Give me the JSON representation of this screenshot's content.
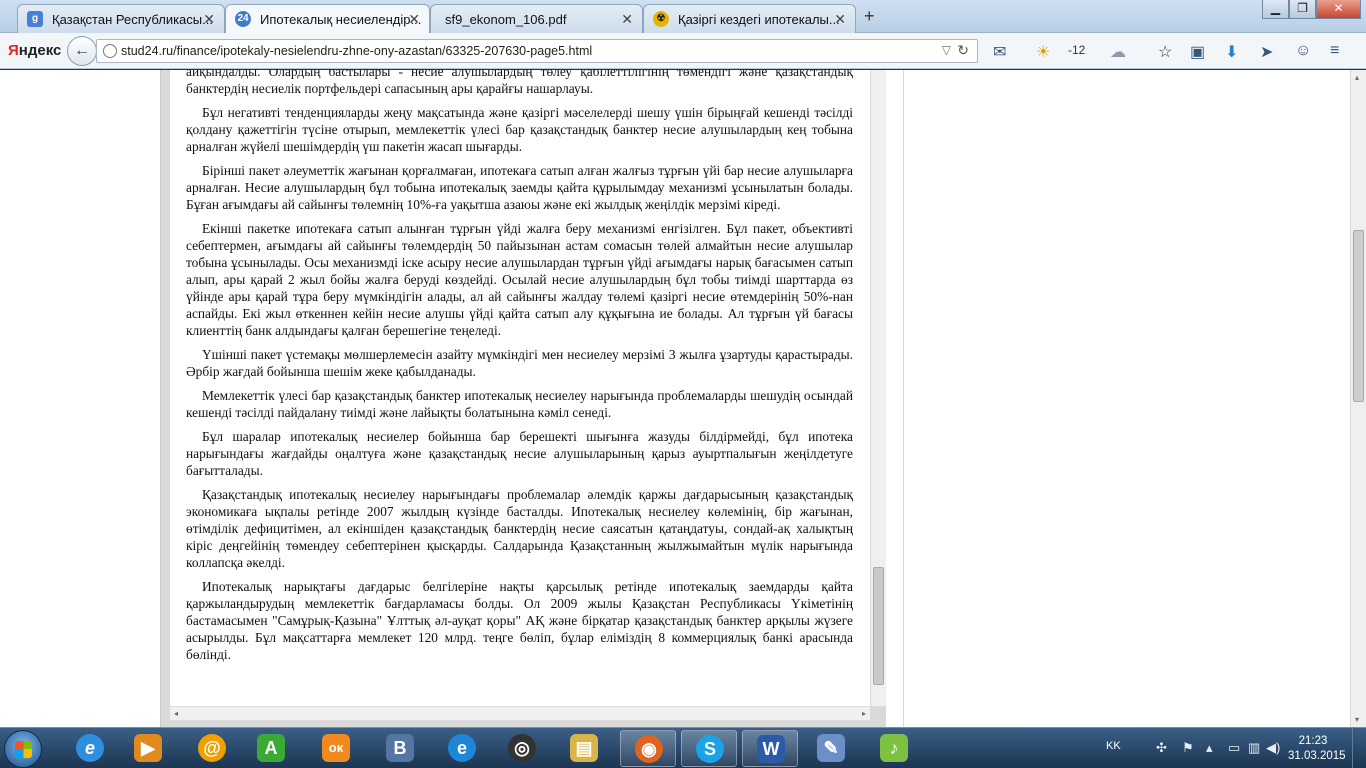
{
  "browser": {
    "tabs": [
      {
        "label": "Қазақстан Республикасы...",
        "icon": "google-plus-icon",
        "color": "#4a7fd4"
      },
      {
        "label": "Ипотекалық несиелендір...",
        "icon": "stud24-icon",
        "color": "#3c7dc9"
      },
      {
        "label": "sf9_ekonom_106.pdf",
        "icon": "",
        "color": ""
      },
      {
        "label": "Қазіргі кездегі ипотекалы...",
        "icon": "radiation-icon",
        "color": "#e8b400"
      }
    ],
    "new_tab": "+",
    "logo_y": "Я",
    "logo_rest": "ндекс",
    "url": "stud24.ru/finance/ipotekaly-nesielendru-zhne-ony-azastan/63325-207630-page5.html",
    "weather_temp": "-12"
  },
  "document": {
    "paragraphs": [
      "айқындалды. Олардың бастылары - несие алушылардың төлеу қабілеттілігінің төмендігі және қазақстандық банктердің несиелік портфельдері сапасының ары қарайғы нашарлауы.",
      "Бұл негативті тенденцияларды жеңу мақсатында және қазіргі мәселелерді шешу үшін бірыңғай кешенді тәсілді қолдану қажеттігін түсіне отырып, мемлекеттік үлесі бар қазақстандық банктер несие алушылардың кең тобына арналған жүйелі шешімдердің үш пакетін жасап шығарды.",
      "Бірінші пакет әлеуметтік жағынан қорғалмаған, ипотекаға сатып алған жалғыз тұрғын үйі бар несие алушыларға арналған. Несие алушылардың бұл тобына ипотекалық заемды қайта құрылымдау механизмі ұсынылатын болады. Бұған ағымдағы ай сайынғы төлемнің 10%-ға уақытша азаюы және екі жылдық жеңілдік мерзімі кіреді.",
      "Екінші пакетке ипотекаға сатып алынған тұрғын үйді жалға беру механизмі енгізілген. Бұл пакет, объективті себептермен, ағымдағы ай сайынғы төлемдердің 50 пайызынан астам сомасын төлей алмайтын несие алушылар тобына ұсынылады. Осы механизмді іске асыру несие алушылардан тұрғын үйді ағымдағы нарық бағасымен сатып алып, ары қарай 2 жыл бойы жалға беруді көздейді. Осылай несие алушылардың бұл тобы тиімді шарттарда өз үйінде ары қарай тұра беру мүмкіндігін алады, ал ай сайынғы жалдау төлемі қазіргі несие өтемдерінің 50%-нан аспайды. Екі жыл өткеннен кейін несие алушы үйді қайта сатып алу құқығына ие болады. Ал тұрғын үй бағасы клиенттің банк алдындағы қалған берешегіне теңеледі.",
      "Үшінші пакет үстемақы мөлшерлемесін азайту мүмкіндігі мен несиелеу мерзімі 3 жылға ұзартуды қарастырады. Әрбір жағдай бойынша шешім жеке қабылданады.",
      "Мемлекеттік үлесі бар қазақстандық банктер ипотекалық несиелеу нарығында проблемаларды шешудің осындай кешенді тәсілді пайдалану тиімді және лайықты болатынына кәміл сенеді.",
      "Бұл шаралар ипотекалық несиелер бойынша бар берешекті шығынға жазуды білдірмейді, бұл ипотека нарығындағы жағдайды оңалтуға және қазақстандық несие алушыларының қарыз ауыртпалығын жеңілдетуге бағытталады.",
      "Қазақстандық ипотекалық несиелеу нарығындағы проблемалар әлемдік қаржы дағдарысының қазақстандық экономикаға ықпалы ретінде 2007 жылдың күзінде басталды. Ипотекалық несиелеу көлемінің, бір жағынан, өтімділік дефицитімен, ал екіншіден қазақстандық банктердің несие саясатын қатаңдатуы, сондай-ақ халықтың кіріс деңгейінің төмендеу себептерінен қысқарды. Салдарында Қазақстанның жылжымайтын мүлік нарығында коллапсқа әкелді.",
      "Ипотекалық нарықтағы дағдарыс белгілеріне нақты қарсылық ретінде ипотекалық заемдарды қайта қаржыландырудың мемлекеттік бағдарламасы болды. Ол 2009 жылы Қазақстан Республикасы Үкіметінің бастамасымен \"Самұрық-Қазына\" Ұлттық әл-ауқат қоры\" АҚ және бірқатар қазақстандық банктер арқылы жүзеге асырылды. Бұл мақсаттарға мемлекет 120 млрд. теңге бөліп, бұлар еліміздің 8 коммерциялық банкі арасында бөлінді."
    ]
  },
  "taskbar": {
    "apps": [
      {
        "name": "internet-explorer",
        "glyph": "e",
        "color": "#2f8ee0"
      },
      {
        "name": "media-player",
        "glyph": "▶",
        "color": "#e08a1e"
      },
      {
        "name": "mail-agent",
        "glyph": "@",
        "color": "#f0a000"
      },
      {
        "name": "green-a-app",
        "glyph": "A",
        "color": "#3aa935"
      },
      {
        "name": "odnoklassniki",
        "glyph": "ок",
        "color": "#f08a1e"
      },
      {
        "name": "vkontakte",
        "glyph": "В",
        "color": "#5476a5"
      },
      {
        "name": "refresh-app",
        "glyph": "e",
        "color": "#1d86d6"
      },
      {
        "name": "cd-burner",
        "glyph": "◎",
        "color": "#333333"
      },
      {
        "name": "file-explorer",
        "glyph": "▤",
        "color": "#d9b448"
      },
      {
        "name": "firefox",
        "glyph": "◉",
        "color": "#e2631e"
      },
      {
        "name": "skype",
        "glyph": "S",
        "color": "#1aa3e8"
      },
      {
        "name": "word",
        "glyph": "W",
        "color": "#2b5ba8"
      },
      {
        "name": "paint",
        "glyph": "✎",
        "color": "#6b8fc6"
      },
      {
        "name": "music-app",
        "glyph": "♪",
        "color": "#7cc142"
      }
    ],
    "lang": "KK",
    "time": "21:23",
    "date": "31.03.2015"
  }
}
